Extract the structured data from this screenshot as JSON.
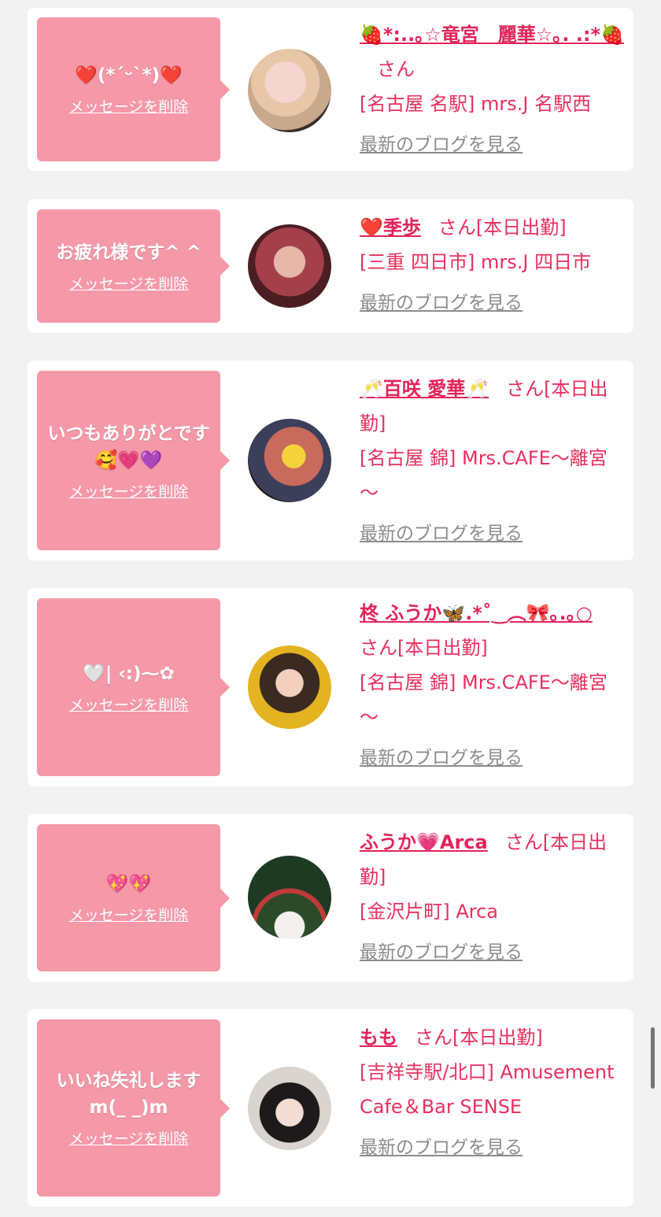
{
  "colors": {
    "bubble": "#f598a8",
    "accent": "#e8305f",
    "link_gray": "#8c8c8c",
    "page_bg": "#f2f2f2"
  },
  "delete_label": "メッセージを削除",
  "blog_label": "最新のブログを見る",
  "san_label": "さん",
  "cards": [
    {
      "message": "❤️(*´ᵕ`*)❤️",
      "name": "🍓*:..｡☆竜宮　麗華☆｡. .:*🍓",
      "attendance": "",
      "shop": "[名古屋 名駅] mrs.J 名駅西"
    },
    {
      "message": "お疲れ様です^ ^",
      "name": "❤️季歩",
      "attendance": "[本日出勤]",
      "shop": "[三重 四日市] mrs.J 四日市"
    },
    {
      "message": "いつもありがとです🥰💗💜",
      "name": "🥂百咲 愛華🥂",
      "attendance": "[本日出勤]",
      "shop": "[名古屋 錦] Mrs.CAFE～離宮～"
    },
    {
      "message": "🤍| ‹:)⁓✿",
      "name": "柊 ふうか🦋.*˚‿︵🎀｡.｡○",
      "attendance": "[本日出勤]",
      "shop": "[名古屋 錦] Mrs.CAFE～離宮～"
    },
    {
      "message": "💖💖",
      "name": "ふうか💗Arca",
      "attendance": "[本日出勤]",
      "shop": "[金沢片町] Arca"
    },
    {
      "message": "いいね失礼しますm(_ _)m",
      "name": "もも",
      "attendance": "[本日出勤]",
      "shop": "[吉祥寺駅/北口] Amusement Cafe＆Bar SENSE"
    }
  ]
}
